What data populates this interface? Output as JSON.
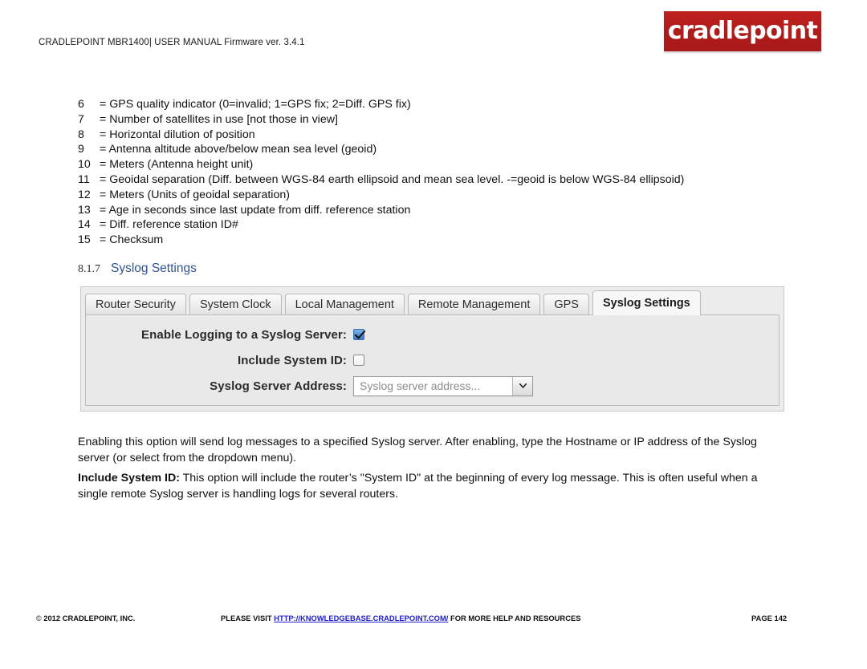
{
  "header": {
    "doc_line": "CRADLEPOINT MBR1400| USER MANUAL Firmware ver. 3.4.1",
    "logo_text": "cradlepoint",
    "logo_color": "#b01c1b"
  },
  "field_list": [
    {
      "num": "6",
      "desc": "= GPS quality indicator (0=invalid; 1=GPS fix; 2=Diff. GPS fix)"
    },
    {
      "num": "7",
      "desc": "= Number of satellites in use [not those in view]"
    },
    {
      "num": "8",
      "desc": "= Horizontal dilution of position"
    },
    {
      "num": "9",
      "desc": "= Antenna altitude above/below mean sea level (geoid)"
    },
    {
      "num": "10",
      "desc": "= Meters  (Antenna height unit)"
    },
    {
      "num": "11",
      "desc": "= Geoidal separation (Diff. between WGS-84 earth ellipsoid and mean sea level.  -=geoid is below WGS-84 ellipsoid)"
    },
    {
      "num": "12",
      "desc": "= Meters  (Units of geoidal separation)"
    },
    {
      "num": "13",
      "desc": "= Age in seconds since last update from diff. reference station"
    },
    {
      "num": "14",
      "desc": "= Diff. reference station ID#"
    },
    {
      "num": "15",
      "desc": "= Checksum"
    }
  ],
  "section": {
    "number": "8.1.7",
    "title": "Syslog Settings",
    "title_color": "#2f5597"
  },
  "panel": {
    "tabs": [
      {
        "label": "Router Security",
        "active": false
      },
      {
        "label": "System Clock",
        "active": false
      },
      {
        "label": "Local Management",
        "active": false
      },
      {
        "label": "Remote Management",
        "active": false
      },
      {
        "label": "GPS",
        "active": false
      },
      {
        "label": "Syslog Settings",
        "active": true
      }
    ],
    "form": {
      "enable_logging_label": "Enable Logging to a Syslog Server:",
      "enable_logging_checked": true,
      "include_system_id_label": "Include System ID:",
      "include_system_id_checked": false,
      "server_address_label": "Syslog Server Address:",
      "server_address_placeholder": "Syslog server address...",
      "server_address_value": "",
      "dropdown_icon": "chevron-down-icon"
    }
  },
  "paragraphs": {
    "p1": "Enabling this option will send log messages to a specified Syslog server. After enabling, type the Hostname or IP address of the Syslog server (or select from the dropdown menu).",
    "p2_lead": "Include System ID:",
    "p2_rest": " This option will include the router’s \"System ID\" at the beginning of every log message. This is often useful when a single remote Syslog server is handling logs for several routers."
  },
  "footer": {
    "copyright": "2012 CRADLEPOINT, INC.",
    "center_before": "PLEASE VISIT ",
    "link": "HTTP://KNOWLEDGEBASE.CRADLEPOINT.COM/",
    "center_after": " FOR MORE HELP AND RESOURCES",
    "page": "PAGE 142",
    "link_color": "#2020c8"
  }
}
